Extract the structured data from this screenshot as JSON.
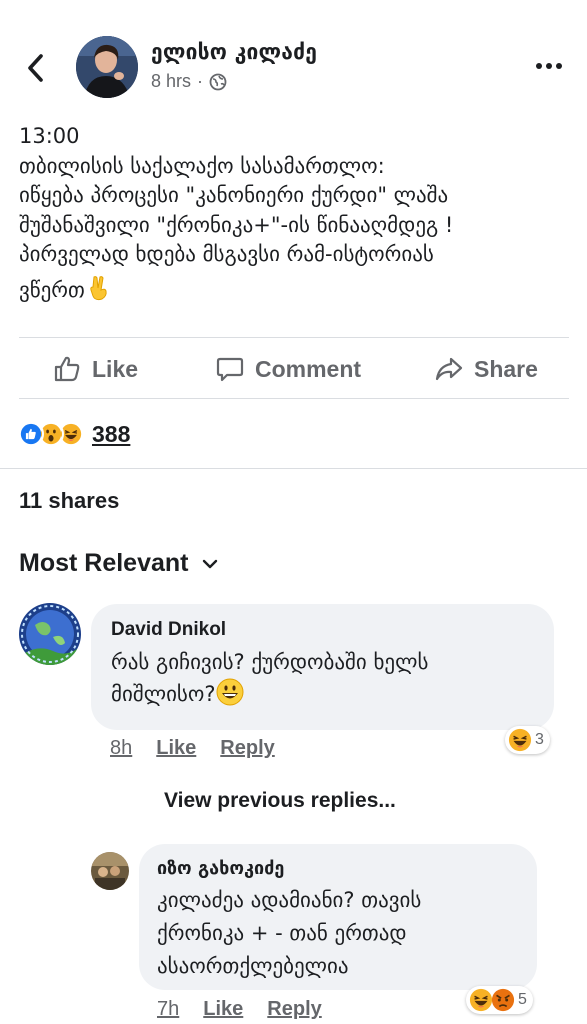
{
  "post": {
    "author": "ელისო კილაძე",
    "time": "8 hrs",
    "meta_sep": "·",
    "text_lines": [
      "13:00",
      "თბილისის საქალაქო სასამართლო:",
      "იწყება პროცესი \"კანონიერი ქურდი\"  ლაშა",
      "შუშანაშვილი \"ქრონიკა+\"-ის წინააღმდეგ !",
      "პირველად ხდება მსგავსი რამ-ისტორიას",
      "ვწერთ"
    ],
    "trailing_emoji": "victory-hand"
  },
  "actions": {
    "like": "Like",
    "comment": "Comment",
    "share": "Share"
  },
  "reactions": {
    "icons": [
      "like",
      "wow",
      "haha"
    ],
    "count": "388"
  },
  "shares": "11 shares",
  "sort": {
    "label": "Most Relevant"
  },
  "comments": [
    {
      "name": "David Dnikol",
      "lines": [
        "რას გიჩივის? ქურდობაში ხელს",
        "მიშლისო?"
      ],
      "emoji": "smiley",
      "time": "8h",
      "like": "Like",
      "reply": "Reply",
      "reaction_count": "3"
    }
  ],
  "view_previous": "View previous replies...",
  "reply": {
    "name": "იზო გახოკიძე",
    "lines": [
      "კილაძეა ადამიანი? თავის",
      "ქრონიკა + - თან ერთად",
      "ასაორთქლებელია"
    ],
    "time": "7h",
    "like": "Like",
    "reply": "Reply",
    "reaction_count": "5"
  },
  "colors": {
    "text": "#1c1e21",
    "secondary": "#65676b",
    "bubble": "#f0f2f5",
    "like_blue": "#1877f2",
    "divider": "#dadde1"
  }
}
